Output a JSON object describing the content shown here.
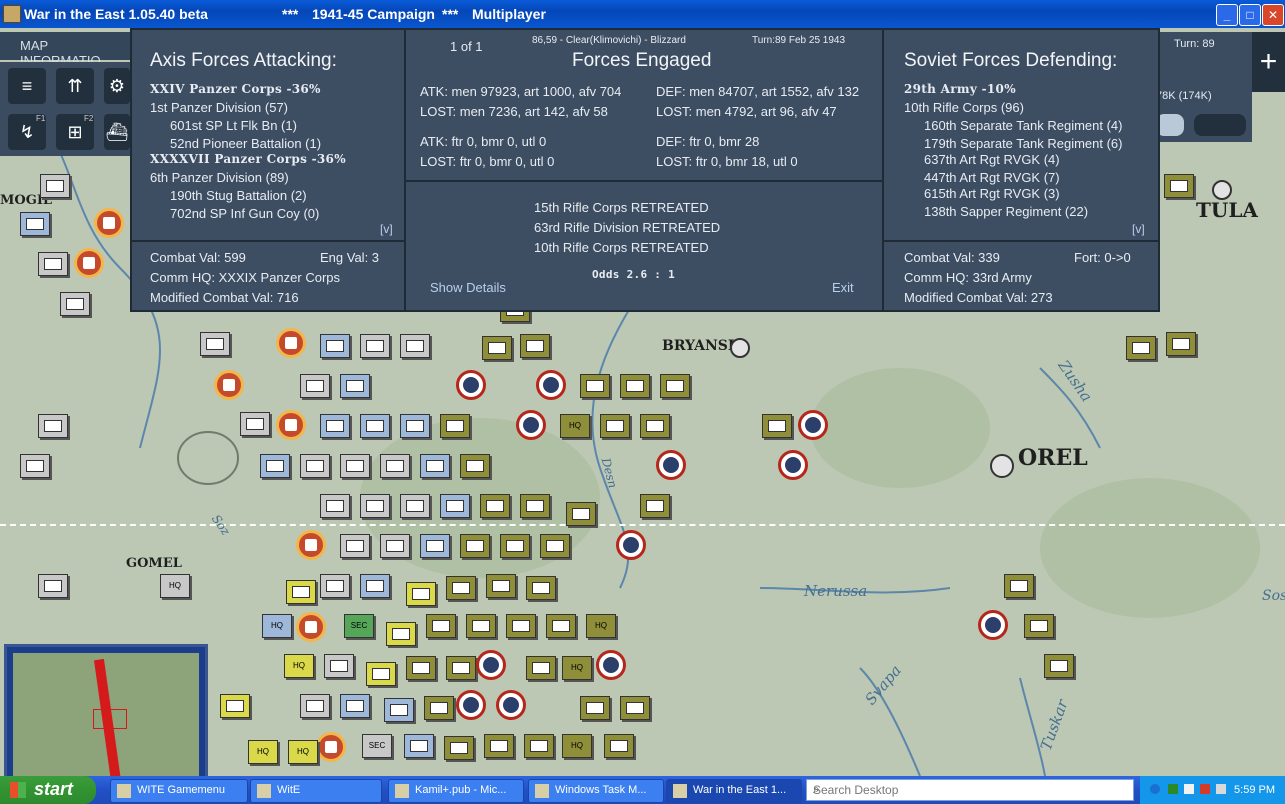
{
  "window": {
    "title_app": "War in the East 1.05.40 beta",
    "stars_left": "***",
    "campaign": "1941-45 Campaign",
    "stars_right": "***",
    "mode": "Multiplayer",
    "minimize": "_",
    "maximize": "□",
    "close": "✕"
  },
  "left_panel": {
    "map_info_label": "MAP INFORMATIO",
    "f1": "F1",
    "f2": "F2"
  },
  "right_panel": {
    "turn": "Turn: 89",
    "manpower": "78K (174K)"
  },
  "map": {
    "cities": [
      "BRYANSK",
      "OREL",
      "TULA",
      "GOMEL",
      "MOGIL"
    ],
    "rivers": [
      "Nerussa",
      "Zusha",
      "Svapa",
      "Tuskar",
      "Soz",
      "Desn",
      "Sos"
    ],
    "hq_label": "HQ",
    "sec_label": "SEC"
  },
  "dialog": {
    "axis": {
      "header": "Axis Forces Attacking:",
      "lines": [
        {
          "text": "XXIV Panzer Corps  -36%",
          "style": "bold"
        },
        {
          "text": "1st Panzer Division (57)",
          "style": "unit"
        },
        {
          "text": "601st SP Lt Flk Bn (1)",
          "style": "sub"
        },
        {
          "text": "52nd Pioneer Battalion (1)",
          "style": "sub"
        },
        {
          "text": "XXXXVII Panzer Corps  -36%",
          "style": "bold"
        },
        {
          "text": "6th Panzer Division (89)",
          "style": "unit"
        },
        {
          "text": "190th Stug Battalion (2)",
          "style": "sub"
        },
        {
          "text": "702nd SP Inf Gun Coy (0)",
          "style": "sub"
        }
      ],
      "expand": "[v]",
      "combat_val": "Combat Val: 599",
      "eng_val": "Eng Val: 3",
      "comm_hq": "Comm HQ: XXXIX Panzer Corps",
      "modified": "Modified Combat Val: 716"
    },
    "middle": {
      "page": "1 of 1",
      "location": "86,59 - Clear(Klimovichi) - Blizzard",
      "turn_date": "Turn:89  Feb 25 1943",
      "header": "Forces Engaged",
      "atk_men": "ATK: men 97923, art 1000, afv 704",
      "lost_men_atk": "LOST: men 7236, art 142, afv 58",
      "def_men": "DEF: men 84707, art 1552, afv 132",
      "lost_men_def": "LOST: men 4792, art 96, afv 47",
      "atk_air": "ATK: ftr 0, bmr 0, utl 0",
      "lost_air_atk": "LOST: ftr 0, bmr 0, utl 0",
      "def_air": "DEF: ftr 0, bmr 28",
      "lost_air_def": "LOST: ftr 0, bmr 18, utl 0",
      "retreats": [
        "15th Rifle Corps RETREATED",
        "63rd Rifle Division RETREATED",
        "10th Rifle Corps RETREATED"
      ],
      "odds": "Odds 2.6 : 1",
      "show_details": "Show Details",
      "exit": "Exit"
    },
    "soviet": {
      "header": "Soviet Forces Defending:",
      "lines": [
        {
          "text": "29th Army  -10%",
          "style": "bold"
        },
        {
          "text": "10th Rifle Corps (96)",
          "style": "unit"
        },
        {
          "text": "160th Separate Tank Regiment (4)",
          "style": "sub"
        },
        {
          "text": "179th Separate Tank Regiment (6)",
          "style": "sub"
        },
        {
          "text": "637th Art Rgt RVGK (4)",
          "style": "sub"
        },
        {
          "text": "447th Art Rgt RVGK (7)",
          "style": "sub"
        },
        {
          "text": "615th Art Rgt RVGK (3)",
          "style": "sub"
        },
        {
          "text": "138th Sapper Regiment (22)",
          "style": "sub"
        }
      ],
      "expand": "[v]",
      "combat_val": "Combat Val: 339",
      "fort": "Fort: 0->0",
      "comm_hq": "Comm HQ: 33rd Army",
      "modified": "Modified Combat Val: 273"
    }
  },
  "taskbar": {
    "start": "start",
    "tasks": [
      "WITE Gamemenu",
      "WitE",
      "Kamil+.pub - Mic...",
      "Windows Task M...",
      "War in the East 1..."
    ],
    "search_placeholder": "Search Desktop",
    "clock": "5:59 PM"
  },
  "colors": {
    "dialog_bg": "#3d4e62",
    "soviet_red": "#b7261b",
    "axis_orange": "#c54a2c",
    "taskbar_blue": "#2250c6"
  }
}
